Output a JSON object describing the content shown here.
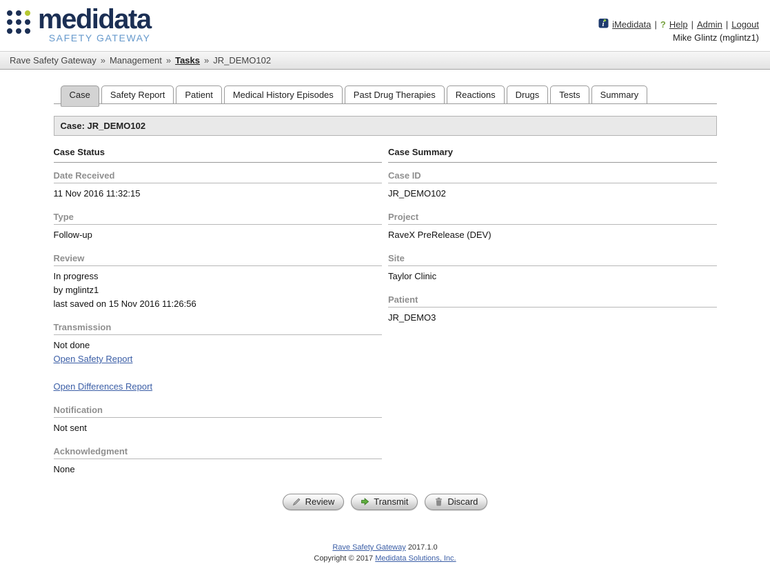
{
  "colors": {
    "brand_navy": "#1b2f54",
    "brand_light_blue": "#6699cc",
    "brand_green": "#b5c832",
    "link_blue": "#3b5ea6",
    "help_green": "#76a23f",
    "transmit_green": "#5fae3e",
    "active_tab_gray": "#d3d3d3",
    "bar_gray": "#e9e9e9"
  },
  "logo": {
    "brand": "medidata",
    "subtitle": "SAFETY GATEWAY"
  },
  "userbar": {
    "separator": "|",
    "links": [
      {
        "label": "iMedidata",
        "icon": "imedidata-icon",
        "name": "imedidata-link"
      },
      {
        "label": "Help",
        "icon": "help-question-icon",
        "name": "help-link"
      },
      {
        "label": "Admin",
        "name": "admin-link"
      },
      {
        "label": "Logout",
        "name": "logout-link"
      }
    ],
    "help_qmark": "?",
    "user": "Mike Glintz (mglintz1)"
  },
  "breadcrumb": {
    "separator": "»",
    "items": [
      {
        "label": "Rave Safety Gateway",
        "link": false
      },
      {
        "label": "Management",
        "link": false
      },
      {
        "label": "Tasks",
        "link": true
      },
      {
        "label": "JR_DEMO102",
        "link": false
      }
    ]
  },
  "tabs": [
    {
      "label": "Case",
      "active": true
    },
    {
      "label": "Safety Report",
      "active": false
    },
    {
      "label": "Patient",
      "active": false
    },
    {
      "label": "Medical History Episodes",
      "active": false
    },
    {
      "label": "Past Drug Therapies",
      "active": false
    },
    {
      "label": "Reactions",
      "active": false
    },
    {
      "label": "Drugs",
      "active": false
    },
    {
      "label": "Tests",
      "active": false
    },
    {
      "label": "Summary",
      "active": false
    }
  ],
  "case_bar": {
    "title": "Case: JR_DEMO102"
  },
  "columns": {
    "left": {
      "title": "Case Status",
      "fields": [
        {
          "label": "Date Received",
          "lines": [
            {
              "text": "11 Nov 2016 11:32:15"
            }
          ]
        },
        {
          "label": "Type",
          "lines": [
            {
              "text": "Follow-up"
            }
          ]
        },
        {
          "label": "Review",
          "lines": [
            {
              "text": "In progress"
            },
            {
              "text": "by mglintz1"
            },
            {
              "text": "last saved on 15 Nov 2016 11:26:56"
            }
          ]
        },
        {
          "label": "Transmission",
          "lines": [
            {
              "text": "Not done"
            },
            {
              "text": "Open Safety Report",
              "link": true,
              "name": "open-safety-report-link"
            },
            {
              "text": "",
              "spacer": true
            },
            {
              "text": "Open Differences Report",
              "link": true,
              "name": "open-differences-report-link"
            }
          ]
        },
        {
          "label": "Notification",
          "lines": [
            {
              "text": "Not sent"
            }
          ]
        },
        {
          "label": "Acknowledgment",
          "lines": [
            {
              "text": "None"
            }
          ]
        }
      ]
    },
    "right": {
      "title": "Case Summary",
      "fields": [
        {
          "label": "Case ID",
          "lines": [
            {
              "text": "JR_DEMO102"
            }
          ]
        },
        {
          "label": "Project",
          "lines": [
            {
              "text": "RaveX PreRelease (DEV)"
            }
          ]
        },
        {
          "label": "Site",
          "lines": [
            {
              "text": "Taylor Clinic"
            }
          ]
        },
        {
          "label": "Patient",
          "lines": [
            {
              "text": "JR_DEMO3"
            }
          ]
        }
      ]
    }
  },
  "actions": [
    {
      "label": "Review",
      "icon": "pencil-icon",
      "name": "review-button"
    },
    {
      "label": "Transmit",
      "icon": "transmit-arrow-icon",
      "name": "transmit-button"
    },
    {
      "label": "Discard",
      "icon": "trash-icon",
      "name": "discard-button"
    }
  ],
  "footer": {
    "app_link": "Rave Safety Gateway",
    "version": "2017.1.0",
    "copyright_prefix": "Copyright © 2017",
    "company_link": "Medidata Solutions, Inc."
  }
}
